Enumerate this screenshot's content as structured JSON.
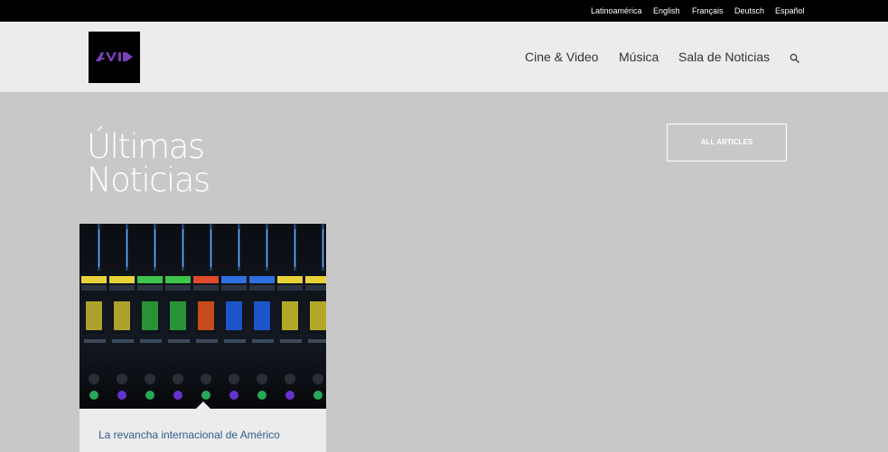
{
  "languages": [
    "Latinoamérica",
    "English",
    "Français",
    "Deutsch",
    "Español"
  ],
  "logo": {
    "text": "AVID"
  },
  "nav": {
    "items": [
      "Cine & Video",
      "Música",
      "Sala de Noticias"
    ],
    "search_icon": "search-icon"
  },
  "hero": {
    "title_line1": "Últimas",
    "title_line2": "Noticias",
    "all_articles_label": "ALL ARTICLES"
  },
  "articles": [
    {
      "title": "La revancha internacional de Américo",
      "image": "mixing-console-photo"
    }
  ],
  "colors": {
    "topbar": "#000000",
    "header": "#ececec",
    "page_bg": "#c8c8c8",
    "logo_accent": "#7b3fb8",
    "article_title": "#2d5b8a"
  }
}
